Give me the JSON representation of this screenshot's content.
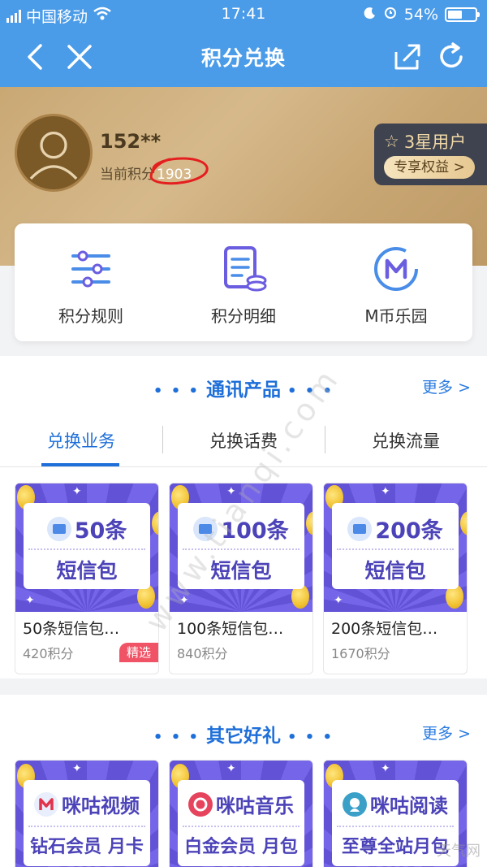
{
  "status": {
    "carrier": "中国移动",
    "time": "17:41",
    "battery": "54%",
    "battery_level": 0.54
  },
  "nav": {
    "title": "积分兑换"
  },
  "member": {
    "name": "152**",
    "points_label": "当前积分",
    "points": "1903",
    "level": "3星用户",
    "perks_btn": "专享权益 >"
  },
  "quick": [
    {
      "label": "积分规则",
      "icon": "list-settings-icon"
    },
    {
      "label": "积分明细",
      "icon": "document-coins-icon"
    },
    {
      "label": "M币乐园",
      "icon": "m-coin-icon"
    }
  ],
  "sections": {
    "telecom": {
      "title": "通讯产品",
      "more": "更多 >"
    },
    "gifts": {
      "title": "其它好礼",
      "more": "更多 >"
    }
  },
  "tabs": [
    "兑换业务",
    "兑换话费",
    "兑换流量"
  ],
  "products": [
    {
      "top": "50条",
      "bottom": "短信包",
      "name": "50条短信包…",
      "price": "420积分",
      "tag": "精选"
    },
    {
      "top": "100条",
      "bottom": "短信包",
      "name": "100条短信包…",
      "price": "840积分",
      "tag": ""
    },
    {
      "top": "200条",
      "bottom": "短信包",
      "name": "200条短信包…",
      "price": "1670积分",
      "tag": ""
    }
  ],
  "gifts": [
    {
      "top": "咪咕视频",
      "bottom": "钻石会员 月卡",
      "icon": "migu-video-icon"
    },
    {
      "top": "咪咕音乐",
      "bottom": "白金会员 月包",
      "icon": "migu-music-icon"
    },
    {
      "top": "咪咕阅读",
      "bottom": "至尊全站月包",
      "icon": "migu-read-icon"
    }
  ],
  "watermark": "www.tianqi.com",
  "watermark2": "天气网"
}
